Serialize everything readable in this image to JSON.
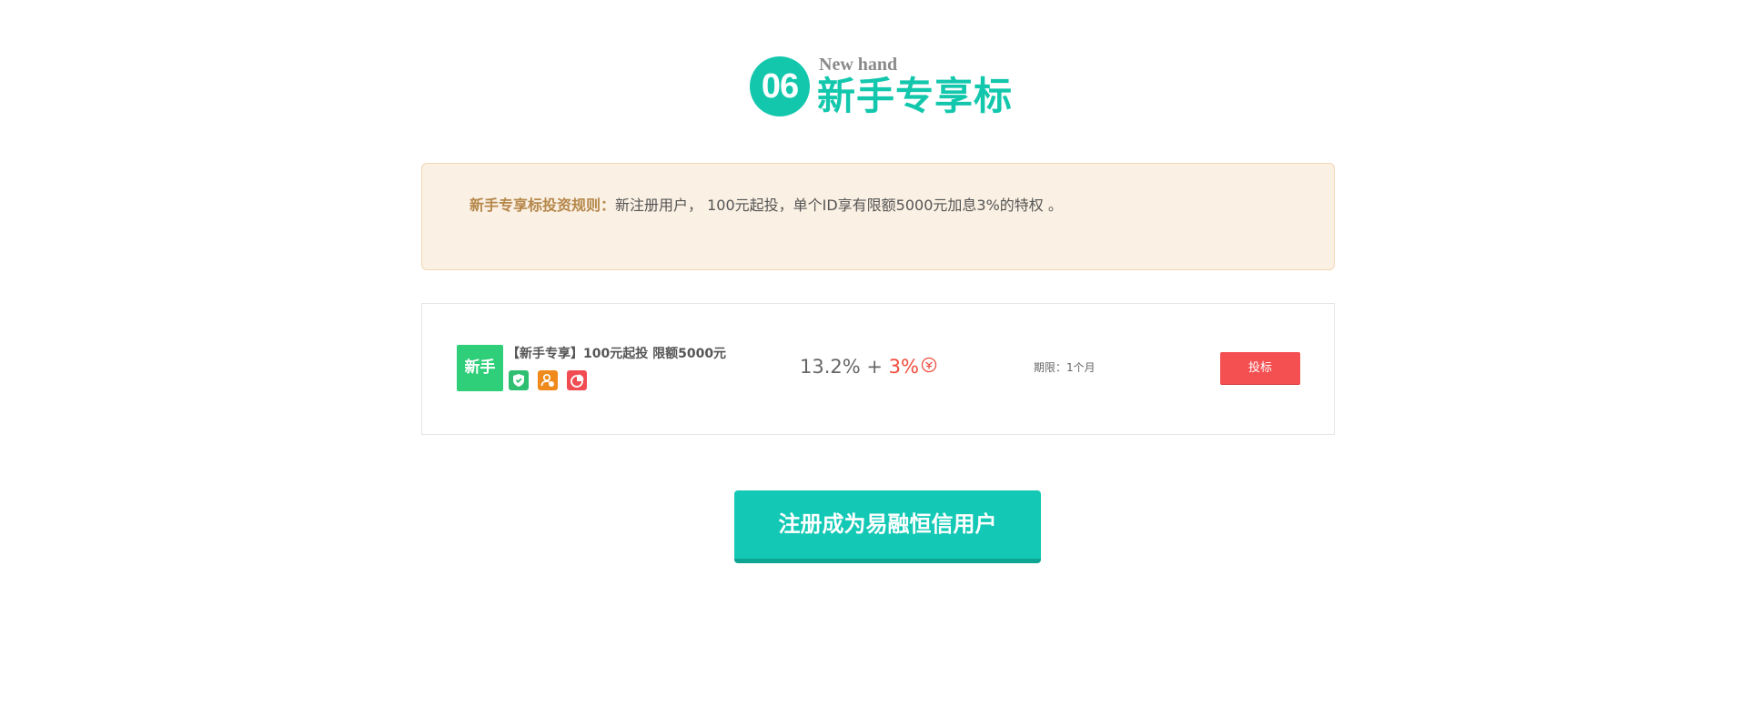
{
  "section": {
    "number": "06",
    "title_en": "New hand",
    "title_cn": "新手专享标"
  },
  "rules": {
    "title": "新手专享标投资规则：",
    "text": "新注册用户， 100元起投，单个ID享有限额5000元加息3%的特权 。"
  },
  "product": {
    "tag": "新手",
    "name": "【新手专享】100元起投 限额5000元",
    "features": [
      {
        "icon": "shield-icon",
        "color": "#2fbf71"
      },
      {
        "icon": "user-coin-icon",
        "color": "#f08a1c"
      },
      {
        "icon": "pie-chart-icon",
        "color": "#f04c52"
      }
    ],
    "rate_base": "13.2%",
    "rate_plus": " + ",
    "rate_extra": "3%",
    "reward_icon": "reward-icon",
    "term": "期限：1个月",
    "invest_label": "投标"
  },
  "register": {
    "label": "注册成为易融恒信用户"
  },
  "colors": {
    "accent": "#13c7ad",
    "rules_bg": "#faf0e3",
    "rules_title": "#b5874a",
    "invest": "#f45052",
    "rate_extra": "#f04c3c"
  }
}
